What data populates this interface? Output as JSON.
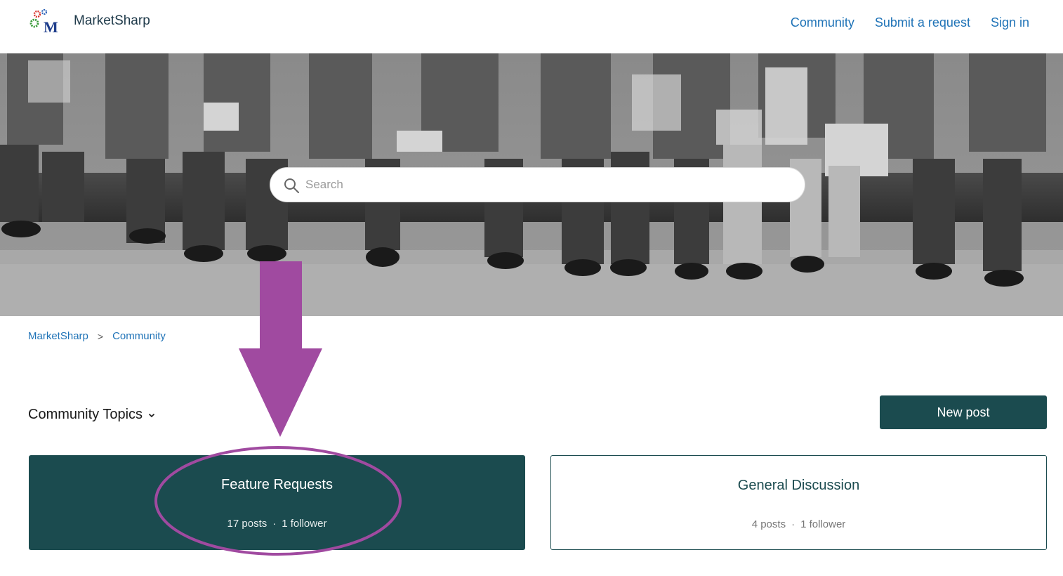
{
  "header": {
    "brand": "MarketSharp",
    "logo_icon": "marketsharp-gears-logo",
    "nav": [
      "Community",
      "Submit a request",
      "Sign in"
    ],
    "link_color": "#1f73b7"
  },
  "hero": {
    "background": "black-and-white photo of workers seated on a beam",
    "search_placeholder": "Search"
  },
  "breadcrumb": {
    "items": [
      "MarketSharp",
      "Community"
    ],
    "separator": ">"
  },
  "topics": {
    "title": "Community Topics",
    "new_post_label": "New post",
    "accent": "#1b4b4f",
    "cards": [
      {
        "title": "Feature Requests",
        "posts": "17 posts",
        "followers": "1 follower",
        "highlighted": true
      },
      {
        "title": "General Discussion",
        "posts": "4 posts",
        "followers": "1 follower",
        "highlighted": false
      }
    ]
  },
  "annotation": {
    "arrow_color": "#a04aa0",
    "description": "purple down arrow pointing to circled Feature Requests card"
  }
}
